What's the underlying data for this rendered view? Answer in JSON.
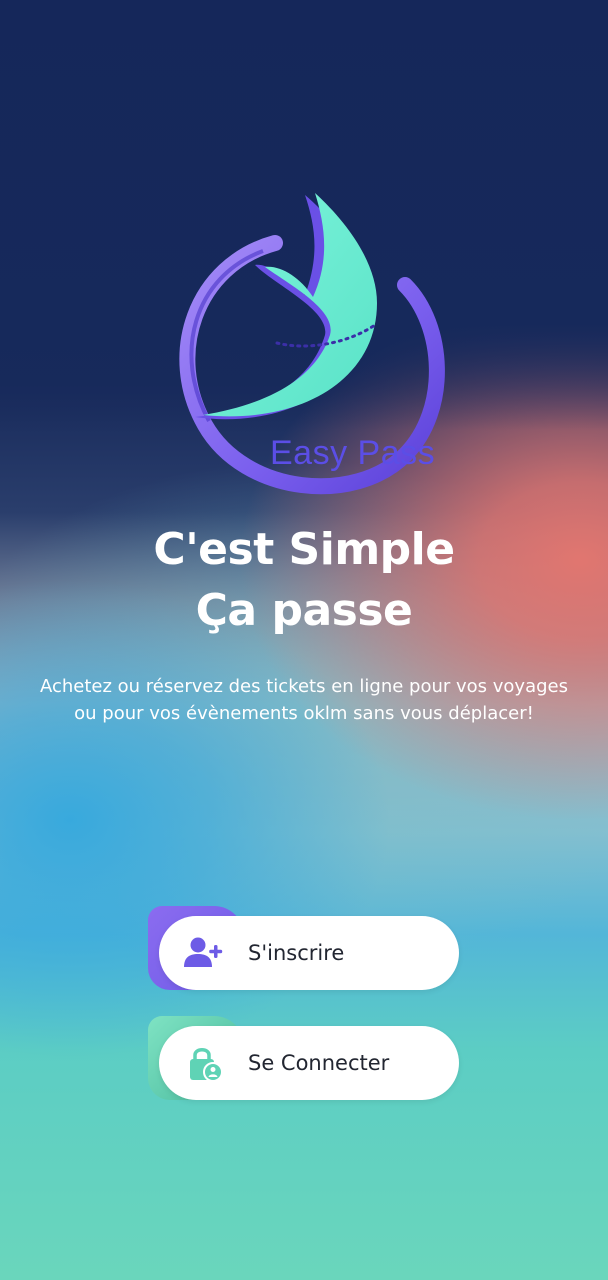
{
  "brand": {
    "name": "Easy Pass"
  },
  "hero": {
    "title_line1": "C'est Simple",
    "title_line2": "Ça passe",
    "subtitle_line1": "Achetez ou réservez des tickets en ligne pour vos voyages",
    "subtitle_line2": "ou pour vos évènements oklm sans vous déplacer!"
  },
  "actions": {
    "signup_label": "S'inscrire",
    "signup_icon": "user-plus-icon",
    "login_label": "Se Connecter",
    "login_icon": "lock-user-icon"
  },
  "colors": {
    "primary_purple": "#6d5be6",
    "accent_mint": "#5ee8cc",
    "background_navy": "#15275a"
  }
}
